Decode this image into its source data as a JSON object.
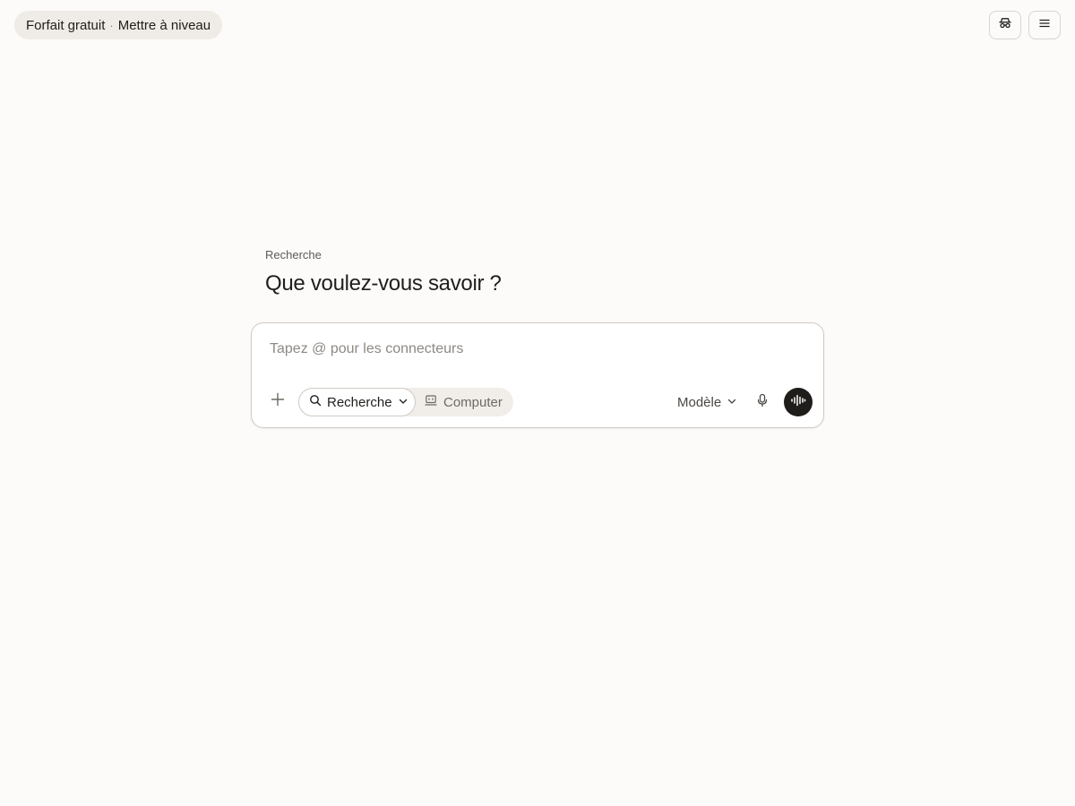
{
  "header": {
    "plan_label": "Forfait gratuit",
    "separator": "·",
    "upgrade_label": "Mettre à niveau",
    "icons": {
      "incognito": "incognito-icon",
      "menu": "menu-icon"
    }
  },
  "main": {
    "kicker": "Recherche",
    "title": "Que voulez-vous savoir ?"
  },
  "composer": {
    "placeholder": "Tapez @ pour les connecteurs",
    "value": "",
    "modes": {
      "research_label": "Recherche",
      "computer_label": "Computer"
    },
    "model_label": "Modèle",
    "icons": {
      "plus": "plus-icon",
      "search": "search-icon",
      "computer": "computer-icon",
      "chevron": "chevron-down-icon",
      "mic": "microphone-icon",
      "voice": "voice-waveform-icon"
    }
  },
  "colors": {
    "background": "#fcfbf9",
    "pill_background": "#efebe6",
    "voice_button": "#1f1d1a",
    "text_primary": "#1f1e1c",
    "text_muted": "#8d8983"
  }
}
